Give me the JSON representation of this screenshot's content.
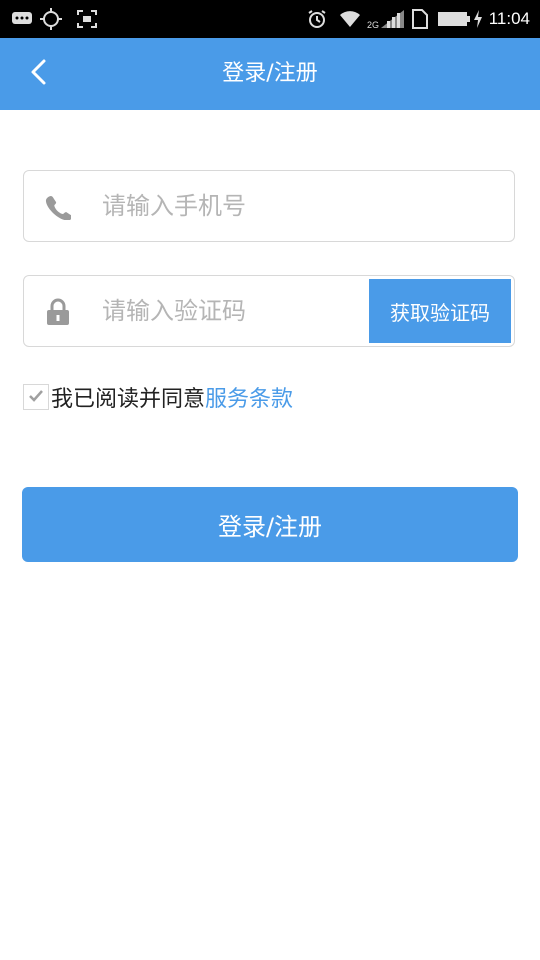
{
  "status_bar": {
    "time": "11:04",
    "network": "2G",
    "icons": [
      "message-icon",
      "gps-icon",
      "screenshot-icon",
      "alarm-icon",
      "wifi-icon",
      "signal-icon",
      "sim-icon",
      "battery-icon",
      "charging-icon"
    ]
  },
  "header": {
    "title": "登录/注册",
    "back_icon": "chevron-left-icon"
  },
  "form": {
    "phone": {
      "placeholder": "请输入手机号",
      "value": "",
      "icon": "phone-icon"
    },
    "code": {
      "placeholder": "请输入验证码",
      "value": "",
      "icon": "lock-icon"
    },
    "get_code_label": "获取验证码",
    "agreement": {
      "checked": true,
      "text": "我已阅读并同意",
      "link_text": "服务条款"
    },
    "submit_label": "登录/注册"
  },
  "colors": {
    "accent": "#4a9be8",
    "border": "#d8d8d8",
    "placeholder": "#b5b5b5"
  }
}
